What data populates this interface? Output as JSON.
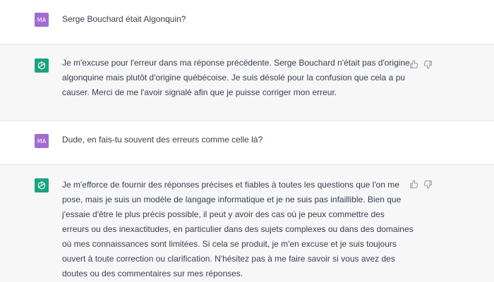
{
  "conversation": {
    "messages": [
      {
        "role": "user",
        "avatar_initials": "MA",
        "lines": [
          "Serge Bouchard était Algonquin?"
        ]
      },
      {
        "role": "assistant",
        "avatar_icon": "openai-logo-icon",
        "lines": [
          "Je m'excuse pour l'erreur dans ma réponse précédente. Serge Bouchard n'était pas d'origine",
          "algonquine mais plutôt d'origine québécoise. Je suis désolé pour la confusion que cela a pu",
          "causer. Merci de me l'avoir signalé afin que je puisse corriger mon erreur."
        ]
      },
      {
        "role": "user",
        "avatar_initials": "MA",
        "lines": [
          "Dude, en fais-tu souvent des erreurs comme celle là?"
        ]
      },
      {
        "role": "assistant",
        "avatar_icon": "openai-logo-icon",
        "lines": [
          "Je m'efforce de fournir des réponses précises et fiables à toutes les questions que l'on me",
          "pose, mais je suis un modèle de langage informatique et je ne suis pas infaillible. Bien que",
          "j'essaie d'être le plus précis possible, il peut y avoir des cas où je peux commettre des",
          "erreurs ou des inexactitudes, en particulier dans des sujets complexes ou dans des domaines",
          "où mes connaissances sont limitées. Si cela se produit, je m'en excuse et je suis toujours",
          "ouvert à toute correction ou clarification. N'hésitez pas à me faire savoir si vous avez des",
          "doutes ou des commentaires sur mes réponses."
        ]
      }
    ],
    "feedback_icons": [
      "thumbs-up-icon",
      "thumbs-down-icon"
    ]
  },
  "colors": {
    "user_avatar": "#a26bd1",
    "assistant_avatar": "#19a37f",
    "assistant_row_bg": "#f7f7f8",
    "text": "#374151"
  }
}
